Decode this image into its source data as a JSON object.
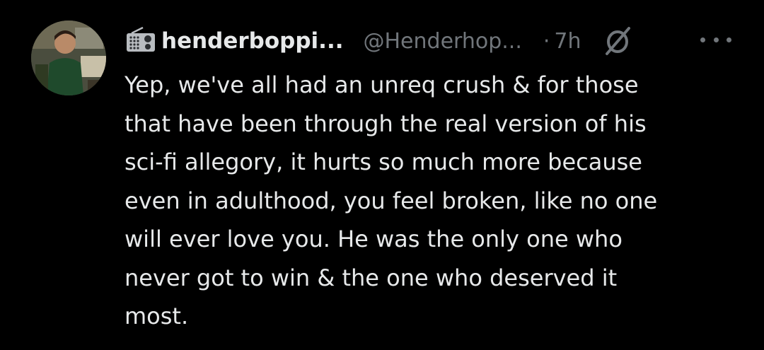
{
  "author": {
    "display_name": "henderboppi...",
    "handle": "@Henderhop...",
    "avatar_icon": "profile-photo",
    "name_prefix_icon": "radio-icon"
  },
  "meta": {
    "separator": "·",
    "time": "7h",
    "badge_icon": "slashed-circle-icon",
    "more_icon": "more-options-icon"
  },
  "tweet": {
    "lines": [
      "Yep, we've all had an unreq crush & for those",
      "that have been through the real version of his",
      "sci-fi allegory, it hurts so much more because",
      "even in adulthood, you feel broken, like no one",
      "will ever love you. He was the only one who",
      "never got to win & the one who deserved it",
      "most."
    ]
  },
  "colors": {
    "background": "#000000",
    "primary_text": "#e7e9ea",
    "secondary_text": "#71767b"
  }
}
